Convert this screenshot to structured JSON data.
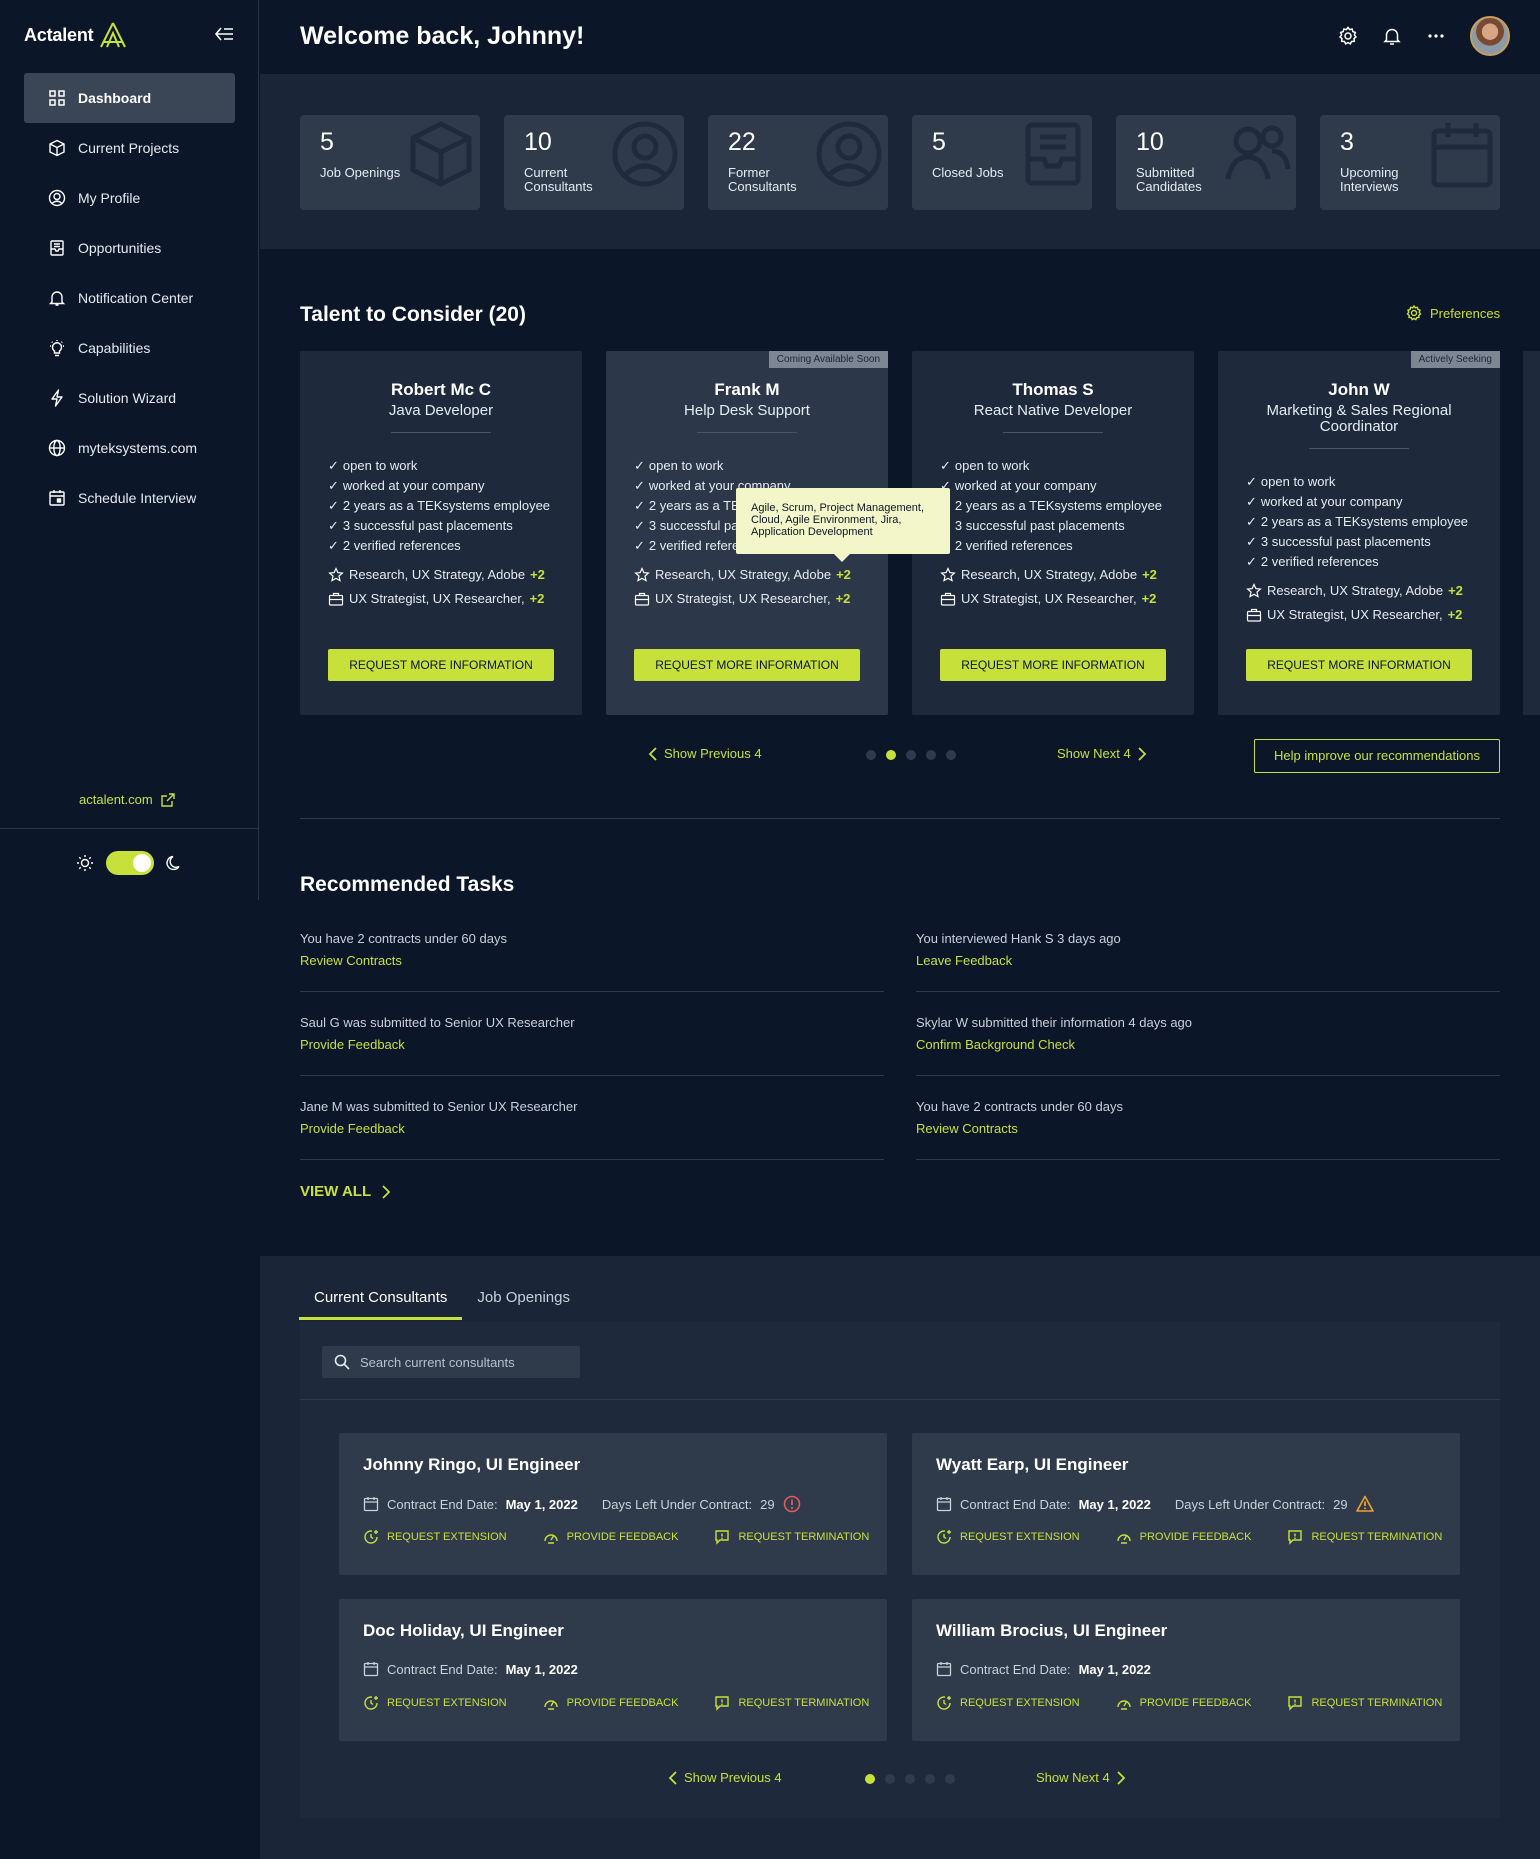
{
  "app": {
    "logo_text": "Actalent"
  },
  "sidebar": {
    "items": [
      {
        "label": "Dashboard",
        "icon": "grid-icon",
        "active": true
      },
      {
        "label": "Current Projects",
        "icon": "cube-icon"
      },
      {
        "label": "My Profile",
        "icon": "user-circle-icon"
      },
      {
        "label": "Opportunities",
        "icon": "inbox-icon"
      },
      {
        "label": "Notification Center",
        "icon": "bell-icon"
      },
      {
        "label": "Capabilities",
        "icon": "lightbulb-icon"
      },
      {
        "label": "Solution Wizard",
        "icon": "bolt-icon"
      },
      {
        "label": "myteksystems.com",
        "icon": "globe-icon"
      },
      {
        "label": "Schedule Interview",
        "icon": "calendar-icon"
      }
    ],
    "external_link": "actalent.com",
    "dark_mode": true
  },
  "header": {
    "welcome": "Welcome back, Johnny!"
  },
  "stats": [
    {
      "value": "5",
      "label": "Job Openings",
      "icon": "cube-icon"
    },
    {
      "value": "10",
      "label": "Current Consultants",
      "icon": "user-circle-icon"
    },
    {
      "value": "22",
      "label": "Former Consultants",
      "icon": "user-circle-icon"
    },
    {
      "value": "5",
      "label": "Closed Jobs",
      "icon": "inbox-icon"
    },
    {
      "value": "10",
      "label": "Submitted Candidates",
      "icon": "users-icon"
    },
    {
      "value": "3",
      "label": "Upcoming Interviews",
      "icon": "calendar-icon"
    }
  ],
  "talent": {
    "title": "Talent to Consider (20)",
    "preferences": "Preferences",
    "cards": [
      {
        "name": "Robert Mc C",
        "role": "Java Developer",
        "badge": "",
        "checks": [
          "open to work",
          "worked at your company",
          "2 years as a TEKsystems employee",
          "3 successful past placements",
          "2 verified references"
        ],
        "skills": "Research, UX Strategy, Adobe",
        "skills_more": "+2",
        "roles": "UX Strategist, UX Researcher,",
        "roles_more": "+2",
        "button": "REQUEST MORE INFORMATION"
      },
      {
        "name": "Frank M",
        "role": "Help Desk Support",
        "badge": "Coming Available Soon",
        "checks": [
          "open to work",
          "worked at your company",
          "2 years as a TEKsystems employee",
          "3 successful past placements",
          "2 verified references"
        ],
        "skills": "Research, UX Strategy, Adobe",
        "skills_more": "+2",
        "roles": "UX Strategist, UX Researcher,",
        "roles_more": "+2",
        "button": "REQUEST MORE INFORMATION"
      },
      {
        "name": "Thomas S",
        "role": "React Native Developer",
        "badge": "",
        "checks": [
          "open to work",
          "worked at your company",
          "2 years as a TEKsystems employee",
          "3 successful past placements",
          "2 verified references"
        ],
        "skills": "Research, UX Strategy, Adobe",
        "skills_more": "+2",
        "roles": "UX Strategist, UX Researcher,",
        "roles_more": "+2",
        "button": "REQUEST MORE INFORMATION"
      },
      {
        "name": "John W",
        "role": "Marketing & Sales Regional Coordinator",
        "badge": "Actively Seeking",
        "checks": [
          "open to work",
          "worked at your company",
          "2 years as a TEKsystems employee",
          "3 successful past placements",
          "2 verified references"
        ],
        "skills": "Research, UX Strategy, Adobe",
        "skills_more": "+2",
        "roles": "UX Strategist, UX Researcher,",
        "roles_more": "+2",
        "button": "REQUEST MORE INFORMATION"
      }
    ],
    "tooltip": "Agile, Scrum, Project Management, Cloud, Agile Environment, Jira, Application Development",
    "prev": "Show Previous 4",
    "next": "Show Next 4",
    "page": 2,
    "pages": 5,
    "help_button": "Help improve our recommendations"
  },
  "tasks": {
    "title": "Recommended Tasks",
    "items": [
      {
        "text": "You have 2 contracts under 60 days",
        "action": "Review Contracts"
      },
      {
        "text": "You interviewed Hank S 3 days ago",
        "action": "Leave Feedback"
      },
      {
        "text": "Saul G was submitted to Senior UX Researcher",
        "action": "Provide Feedback"
      },
      {
        "text": "Skylar W submitted their information 4 days ago",
        "action": "Confirm Background Check"
      },
      {
        "text": "Jane M was submitted to Senior UX Researcher",
        "action": "Provide Feedback"
      },
      {
        "text": "You have 2 contracts under 60 days",
        "action": "Review Contracts"
      }
    ],
    "view_all": "VIEW ALL"
  },
  "consultants": {
    "tabs": [
      "Current Consultants",
      "Job Openings"
    ],
    "active_tab": 0,
    "search_placeholder": "Search current consultants",
    "end_label": "Contract End Date:",
    "days_label": "Days Left Under Contract:",
    "actions": [
      "REQUEST EXTENSION",
      "PROVIDE FEEDBACK",
      "REQUEST TERMINATION"
    ],
    "cards": [
      {
        "name": "Johnny Ringo, UI Engineer",
        "end_date": "May 1, 2022",
        "days_left": "29",
        "alert": "error"
      },
      {
        "name": "Wyatt Earp, UI Engineer",
        "end_date": "May 1, 2022",
        "days_left": "29",
        "alert": "warning"
      },
      {
        "name": "Doc Holiday, UI Engineer",
        "end_date": "May 1, 2022",
        "days_left": "",
        "alert": ""
      },
      {
        "name": "William Brocius, UI Engineer",
        "end_date": "May 1, 2022",
        "days_left": "",
        "alert": ""
      }
    ],
    "prev": "Show Previous 4",
    "next": "Show Next 4",
    "page": 1,
    "pages": 5
  },
  "colors": {
    "accent": "#c8e03a",
    "background": "#0b1628",
    "card": "#2f3b4b",
    "error": "#e05a5a",
    "warning": "#f0a030"
  }
}
